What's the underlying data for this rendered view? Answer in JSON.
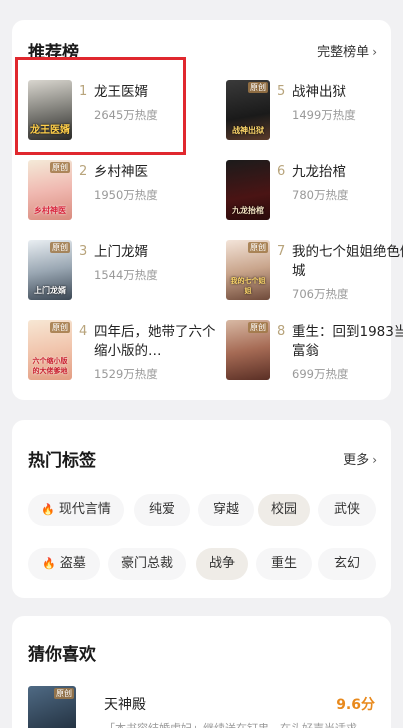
{
  "ranking": {
    "title": "推荐榜",
    "more_label": "完整榜单",
    "books": [
      {
        "rank": "1",
        "title": "龙王医婿",
        "heat": "2645万热度",
        "cover_text": "龙王医婿",
        "cover_tag": ""
      },
      {
        "rank": "2",
        "title": "乡村神医",
        "heat": "1950万热度",
        "cover_text": "乡村神医",
        "cover_tag": "原创"
      },
      {
        "rank": "3",
        "title": "上门龙婿",
        "heat": "1544万热度",
        "cover_text": "上门龙婿",
        "cover_tag": "原创"
      },
      {
        "rank": "4",
        "title": "四年后，她带了六个缩小版的…",
        "heat": "1529万热度",
        "cover_text": "六个缩小版的大佬爹地",
        "cover_tag": "原创"
      },
      {
        "rank": "5",
        "title": "战神出狱",
        "heat": "1499万热度",
        "cover_text": "战神出狱",
        "cover_tag": "原创"
      },
      {
        "rank": "6",
        "title": "九龙抬棺",
        "heat": "780万热度",
        "cover_text": "九龙抬棺",
        "cover_tag": ""
      },
      {
        "rank": "7",
        "title": "我的七个姐姐绝色倾城",
        "heat": "706万热度",
        "cover_text": "我的七个姐姐",
        "cover_tag": "原创"
      },
      {
        "rank": "8",
        "title": "重生：回到1983当富翁",
        "heat": "699万热度",
        "cover_text": "",
        "cover_tag": "原创"
      }
    ]
  },
  "tags": {
    "title": "热门标签",
    "more_label": "更多",
    "row1": [
      "现代言情",
      "纯爱",
      "穿越",
      "校园",
      "武侠"
    ],
    "row2": [
      "盗墓",
      "豪门总裁",
      "战争",
      "重生",
      "玄幻"
    ]
  },
  "guess": {
    "title": "猜你喜欢",
    "book_title": "天神殿",
    "score": "9.6分",
    "desc": "「本书容结婚虐妃」继续送在钉串，在头好声当适求",
    "cover_tag": "原创"
  },
  "colors": {
    "accent_orange": "#e8891c",
    "highlight_red": "#e0282e",
    "rank_gold": "#b8a47c"
  }
}
